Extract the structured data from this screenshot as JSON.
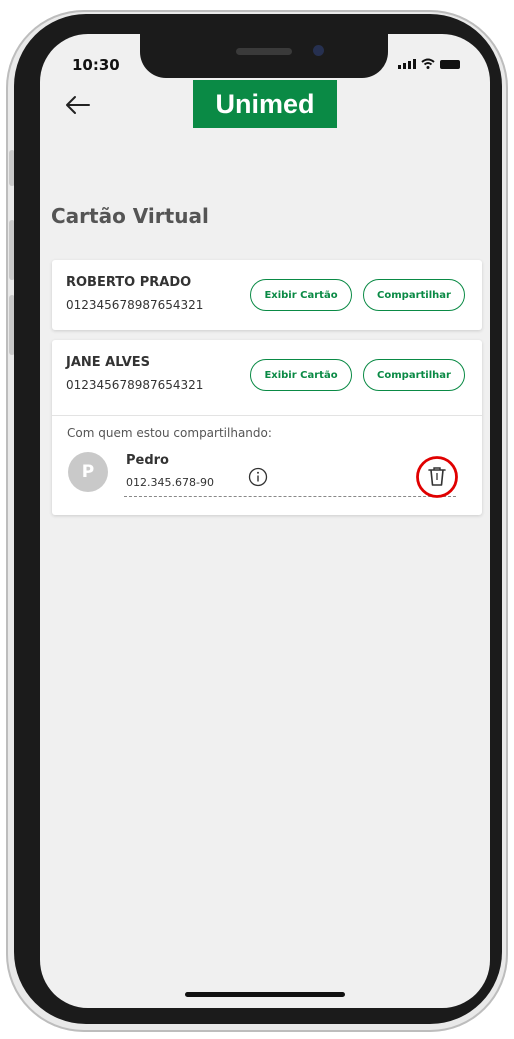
{
  "status_bar": {
    "time": "10:30"
  },
  "header": {
    "logo_text": "Unimed",
    "back_icon": "arrow-left-icon"
  },
  "page": {
    "title": "Cartão Virtual"
  },
  "cards": [
    {
      "name": "ROBERTO PRADO",
      "number": "012345678987654321",
      "view_label": "Exibir Cartão",
      "share_label": "Compartilhar"
    },
    {
      "name": "JANE ALVES",
      "number": "012345678987654321",
      "view_label": "Exibir Cartão",
      "share_label": "Compartilhar",
      "shared_section_label": "Com quem estou compartilhando:",
      "shared_with": [
        {
          "initial": "P",
          "name": "Pedro",
          "doc": "012.345.678-90"
        }
      ]
    }
  ],
  "colors": {
    "brand": "#0a8a45",
    "highlight": "#e00000",
    "background": "#f0f0f0"
  }
}
